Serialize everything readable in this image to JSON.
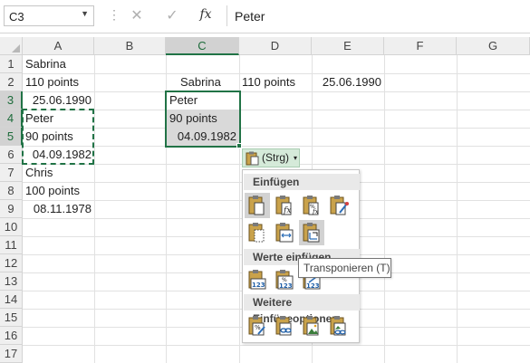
{
  "formula_bar": {
    "name_box": "C3",
    "cancel_icon": "✕",
    "enter_icon": "✓",
    "fx_label": "fx",
    "content": "Peter"
  },
  "columns": [
    "A",
    "B",
    "C",
    "D",
    "E",
    "F",
    "G"
  ],
  "selected_column": "C",
  "rows": [
    "1",
    "2",
    "3",
    "4",
    "5",
    "6",
    "7",
    "8",
    "9",
    "10",
    "11",
    "12",
    "13",
    "14",
    "15",
    "16",
    "17"
  ],
  "selected_rows": [
    "3",
    "4",
    "5"
  ],
  "cells": {
    "A1": "Sabrina",
    "A2": "110 points",
    "A3": "25.06.1990",
    "A4": "Peter",
    "A5": "90 points",
    "A6": "04.09.1982",
    "A7": "Chris",
    "A8": "100 points",
    "A9": "08.11.1978",
    "C2": "Sabrina",
    "D2": "110 points",
    "E2": "25.06.1990",
    "C3": "Peter",
    "C4": "90 points",
    "C5": "04.09.1982"
  },
  "paste_button": {
    "label": "(Strg)",
    "icon": "clipboard-icon",
    "arrow": "▾"
  },
  "paste_menu": {
    "sections": [
      "Einfügen",
      "Werte einfügen",
      "Weitere Einfügeoptionen"
    ],
    "highlight_color": "#d2d2d2",
    "accent_color": "#217346",
    "tooltip": "Transponieren (T)"
  }
}
